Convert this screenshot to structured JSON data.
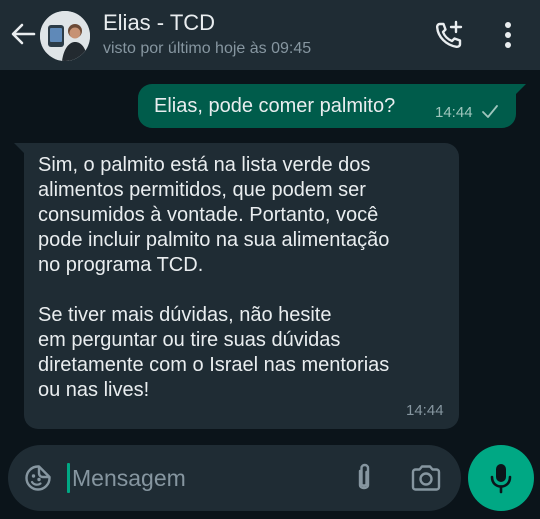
{
  "header": {
    "contact_name": "Elias - TCD",
    "last_seen": "visto por último hoje às 09:45",
    "icons": {
      "back": "arrow-left-icon",
      "call": "add-call-icon",
      "menu": "more-vert-icon"
    }
  },
  "messages": [
    {
      "direction": "outgoing",
      "text": "Elias, pode comer palmito?",
      "time": "14:44",
      "status": "sent"
    },
    {
      "direction": "incoming",
      "text": "Sim, o palmito está na lista verde dos\nalimentos permitidos, que podem ser\nconsumidos à vontade. Portanto, você\npode incluir palmito na sua alimentação\nno programa TCD.\n\nSe tiver mais dúvidas, não hesite\nem perguntar ou tire suas dúvidas\ndiretamente com o Israel nas mentorias\nou nas lives!",
      "time": "14:44"
    }
  ],
  "composer": {
    "placeholder": "Mensagem",
    "value": "",
    "icons": {
      "emoji": "sticker-emoji-icon",
      "attach": "paperclip-icon",
      "camera": "camera-icon",
      "mic": "microphone-icon"
    }
  },
  "colors": {
    "background": "#0b141a",
    "header": "#1f2c34",
    "outgoing_bubble": "#005c4b",
    "incoming_bubble": "#1f2c34",
    "accent": "#00a884",
    "text": "#e9edef",
    "muted": "#8696a0"
  }
}
